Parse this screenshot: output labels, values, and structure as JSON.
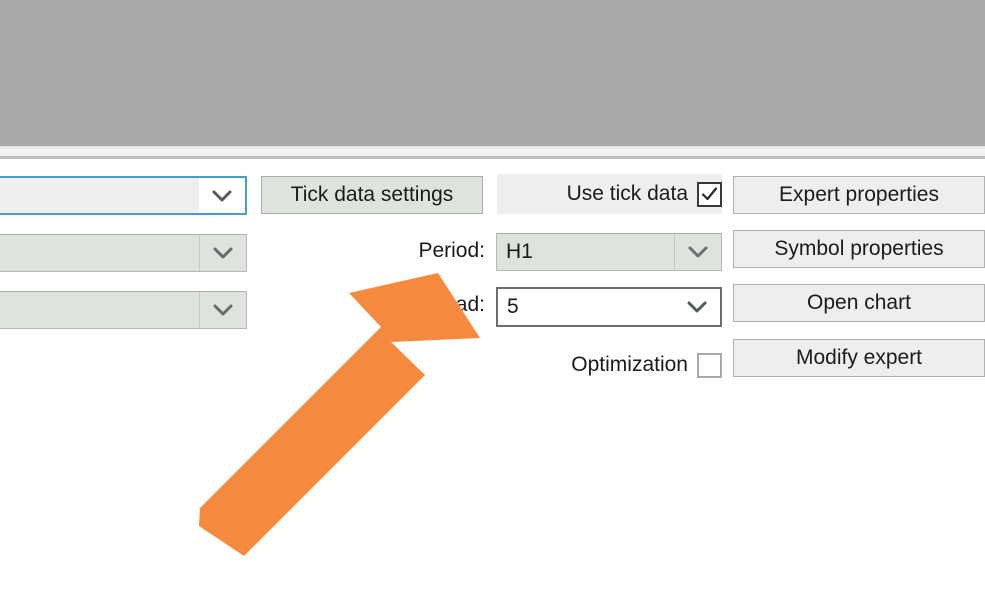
{
  "window": {
    "top_band_color": "#aaaaab",
    "panel_background": "#ffffff"
  },
  "colors": {
    "accent_focus": "#4a9ad4",
    "annotation_arrow": "#f58a3f",
    "button_face": "#eeeeee",
    "disabled_field": "#dfe3dd",
    "text": "#1b1b1b"
  },
  "left_column": {
    "comboboxes": [
      {
        "name": "expert-advisor-combo",
        "value": "",
        "state": "focused"
      },
      {
        "name": "symbol-combo",
        "value": "",
        "state": "disabled"
      },
      {
        "name": "model-combo",
        "value": "",
        "state": "disabled"
      }
    ]
  },
  "middle_column": {
    "tick_data_settings_button": "Tick data settings"
  },
  "settings": {
    "use_tick_data": {
      "label": "Use tick data",
      "checked": true
    },
    "period": {
      "label": "Period:",
      "value": "H1",
      "state": "disabled"
    },
    "spread": {
      "label": "Spread:",
      "value": "5",
      "state": "editable"
    },
    "optimization": {
      "label": "Optimization",
      "checked": false
    }
  },
  "right_column": {
    "buttons": [
      {
        "name": "expert-properties-button",
        "label": "Expert properties"
      },
      {
        "name": "symbol-properties-button",
        "label": "Symbol properties"
      },
      {
        "name": "open-chart-button",
        "label": "Open chart"
      },
      {
        "name": "modify-expert-button",
        "label": "Modify expert"
      }
    ]
  },
  "annotation": {
    "type": "arrow",
    "points_to": "spread-combo",
    "color": "#f58a3f"
  }
}
